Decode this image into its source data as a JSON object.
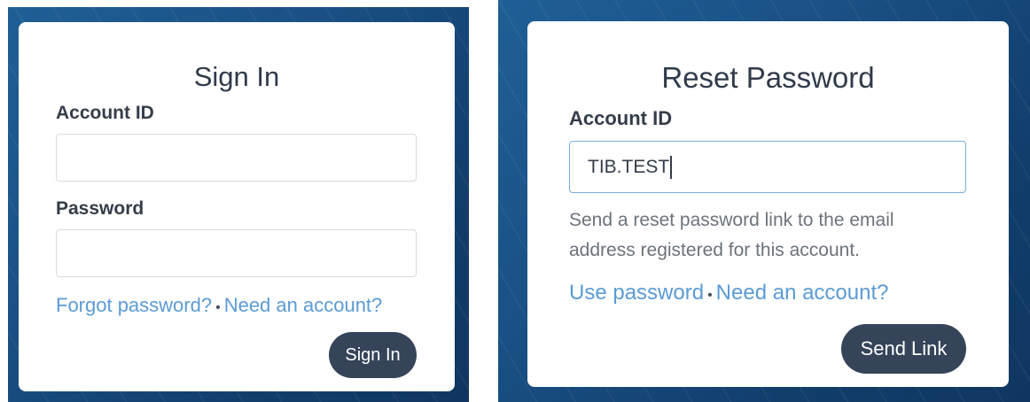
{
  "signin": {
    "title": "Sign In",
    "account_label": "Account ID",
    "account_value": "",
    "password_label": "Password",
    "password_value": "",
    "forgot_link": "Forgot password?",
    "separator": "•",
    "need_account_link": "Need an account?",
    "submit_label": "Sign In"
  },
  "reset": {
    "title": "Reset Password",
    "account_label": "Account ID",
    "account_value": "TIB.TEST",
    "helper_text": "Send a reset password link to the email address registered for this account.",
    "use_password_link": "Use password",
    "separator": "•",
    "need_account_link": "Need an account?",
    "submit_label": "Send Link"
  },
  "colors": {
    "background_blue": "#1a5186",
    "button": "#354459",
    "link": "#5b9bd5",
    "focus_border": "#7aaee0"
  }
}
